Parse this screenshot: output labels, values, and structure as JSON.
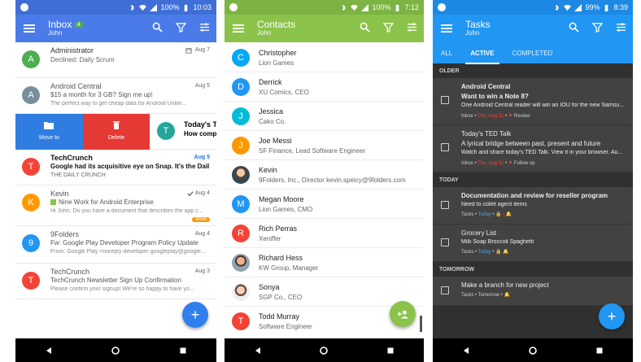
{
  "colors": {
    "inbox_bar": "#4a7be8",
    "contacts_bar": "#8bc34a",
    "tasks_bar": "#2196f3",
    "fab_blue": "#2f80ed",
    "move_blue": "#2f7de1",
    "delete_red": "#e53935",
    "work_badge": "#ff9800"
  },
  "inbox": {
    "status_time": "10:03",
    "status_battery": "100%",
    "title": "Inbox",
    "badge": "4",
    "subtitle": "John",
    "swipe": {
      "move_label": "Move to",
      "delete_label": "Delete",
      "peek_title": "Today's T",
      "peek_line": "How comp"
    },
    "items": [
      {
        "avatar": "A",
        "color": "#4caf50",
        "from": "Administrator",
        "subject": "Declined: Daily Scrum",
        "preview": "",
        "date": "Aug 7"
      },
      {
        "avatar": "A",
        "color": "#78909c",
        "from": "Android Central",
        "subject": "$15 a month for 3 GB? Sign me up!",
        "preview": "The perfect way to get cheap data for Android Unlim...",
        "date": "Aug 5"
      },
      {
        "avatar": "T",
        "color": "#f44336",
        "from": "TechCrunch",
        "subject": "Google had its acquisitive eye on Snap. It's the Dail...",
        "preview": "THE DAILY CRUNCH",
        "date": "Aug 5"
      },
      {
        "avatar": "K",
        "color": "#ff9800",
        "from": "Kevin",
        "subject": "Nine Work for Android Enterprise",
        "preview": "Hi John, Do you have a document that describes the app c...",
        "date": "Aug 4",
        "badge": "Work"
      },
      {
        "avatar": "9",
        "color": "#2196f3",
        "from": "9Folders",
        "subject": "Fw: Google Play Developer Program Policy Update",
        "preview": "From: Google Play <noreply-developer-googleplay@google...",
        "date": "Aug 4"
      },
      {
        "avatar": "T",
        "color": "#f44336",
        "from": "TechCrunch",
        "subject": "TechCrunch Newsletter Sign Up Confirmation",
        "preview": "Please confirm your signup! We're so happy to have yo...",
        "date": "Aug 3"
      }
    ]
  },
  "contacts": {
    "status_time": "7:12",
    "status_battery": "100%",
    "title": "Contacts",
    "subtitle": "John",
    "items": [
      {
        "avatar": "C",
        "color": "#03a9f4",
        "name": "Christopher",
        "detail": "Lion Games"
      },
      {
        "avatar": "D",
        "color": "#2196f3",
        "name": "Derrick",
        "detail": "XU Comics, CEO"
      },
      {
        "avatar": "J",
        "color": "#00bcd4",
        "name": "Jessica",
        "detail": "Cako Co."
      },
      {
        "avatar": "J",
        "color": "#ff9800",
        "name": "Joe Messi",
        "detail": "SF Finance, Lead Software Engineer"
      },
      {
        "avatar": "",
        "color": "#8d6e63",
        "name": "Kevin",
        "detail": "9Folders, Inc., Director kevin.speicy@9folders.com",
        "photo": true
      },
      {
        "avatar": "M",
        "color": "#2196f3",
        "name": "Megan Moore",
        "detail": "Lion Games, CMO"
      },
      {
        "avatar": "R",
        "color": "#f44336",
        "name": "Rich Perras",
        "detail": "Xeniffer"
      },
      {
        "avatar": "",
        "color": "#a1887f",
        "name": "Richard Hess",
        "detail": "KW Group, Manager",
        "photo": true
      },
      {
        "avatar": "",
        "color": "#bcaaa4",
        "name": "Sonya",
        "detail": "SGP Co., CEO",
        "photo": true
      },
      {
        "avatar": "T",
        "color": "#f44336",
        "name": "Todd Murray",
        "detail": "Software Engineer"
      }
    ]
  },
  "tasks": {
    "status_time": "8:39",
    "status_battery": "99%",
    "title": "Tasks",
    "subtitle": "John",
    "tabs": [
      "ALL",
      "ACTIVE",
      "COMPLETED"
    ],
    "sections": {
      "older": "OLDER",
      "today": "TODAY",
      "tomorrow": "TOMORROW"
    },
    "older": [
      {
        "title": "Android Central",
        "line": "Want to win a Note 8?",
        "desc": "One Android Central reader will win an IOU for the new Samsu...",
        "meta_prefix": "Inbox •",
        "date": "Thu, Aug 31",
        "tag": "Review"
      },
      {
        "title": "Today's TED Talk",
        "line": "A lyrical bridge between past, present and future",
        "desc": "Watch and share today's TED Talk. View it in your browser. Au...",
        "meta_prefix": "Inbox •",
        "date": "Thu, Aug 31",
        "tag": "Follow up"
      }
    ],
    "today": [
      {
        "title": "Documentation and review for reseller program",
        "line": "Need to collet agent items",
        "meta_prefix": "Tasks •",
        "date": "Today"
      },
      {
        "title": "Grocery List",
        "line": "Milk Soap Broccoli Spaghetti",
        "meta_prefix": "Tasks •",
        "date": "Today"
      }
    ],
    "tomorrow": [
      {
        "title": "Make a branch for new project",
        "meta": "Tasks • Tomorrow •"
      }
    ]
  }
}
